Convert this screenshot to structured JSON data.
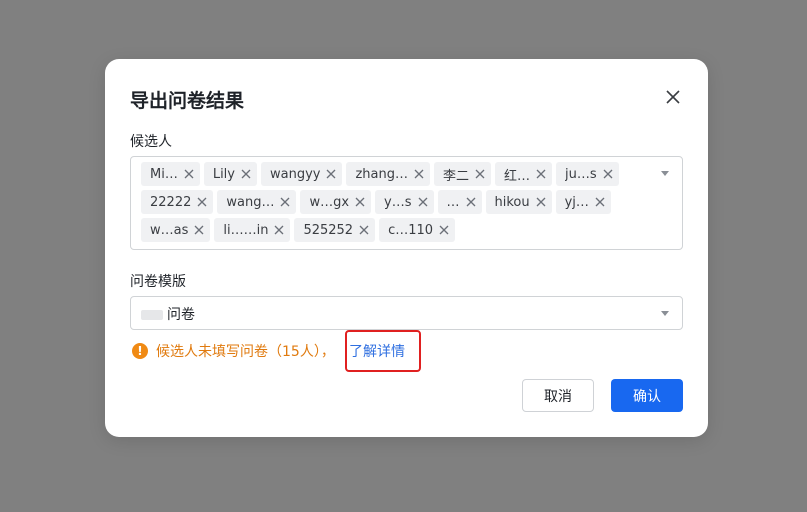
{
  "dialog": {
    "title": "导出问卷结果",
    "candidates_label": "候选人",
    "candidates": [
      "Mi…",
      "Lily",
      "wangyy",
      "zhang…",
      "李二",
      "红…",
      "ju…s",
      "22222",
      "wang…",
      "w…gx",
      "y…s",
      "…",
      "hikou",
      "yj…",
      "w…as",
      "li……in",
      "525252",
      "c…110"
    ],
    "template_label": "问卷模版",
    "template_value": "问卷",
    "warning_text": "候选人未填写问卷（15人），",
    "warning_icon": "!",
    "detail_link": "了解详情",
    "cancel_label": "取消",
    "confirm_label": "确认"
  }
}
